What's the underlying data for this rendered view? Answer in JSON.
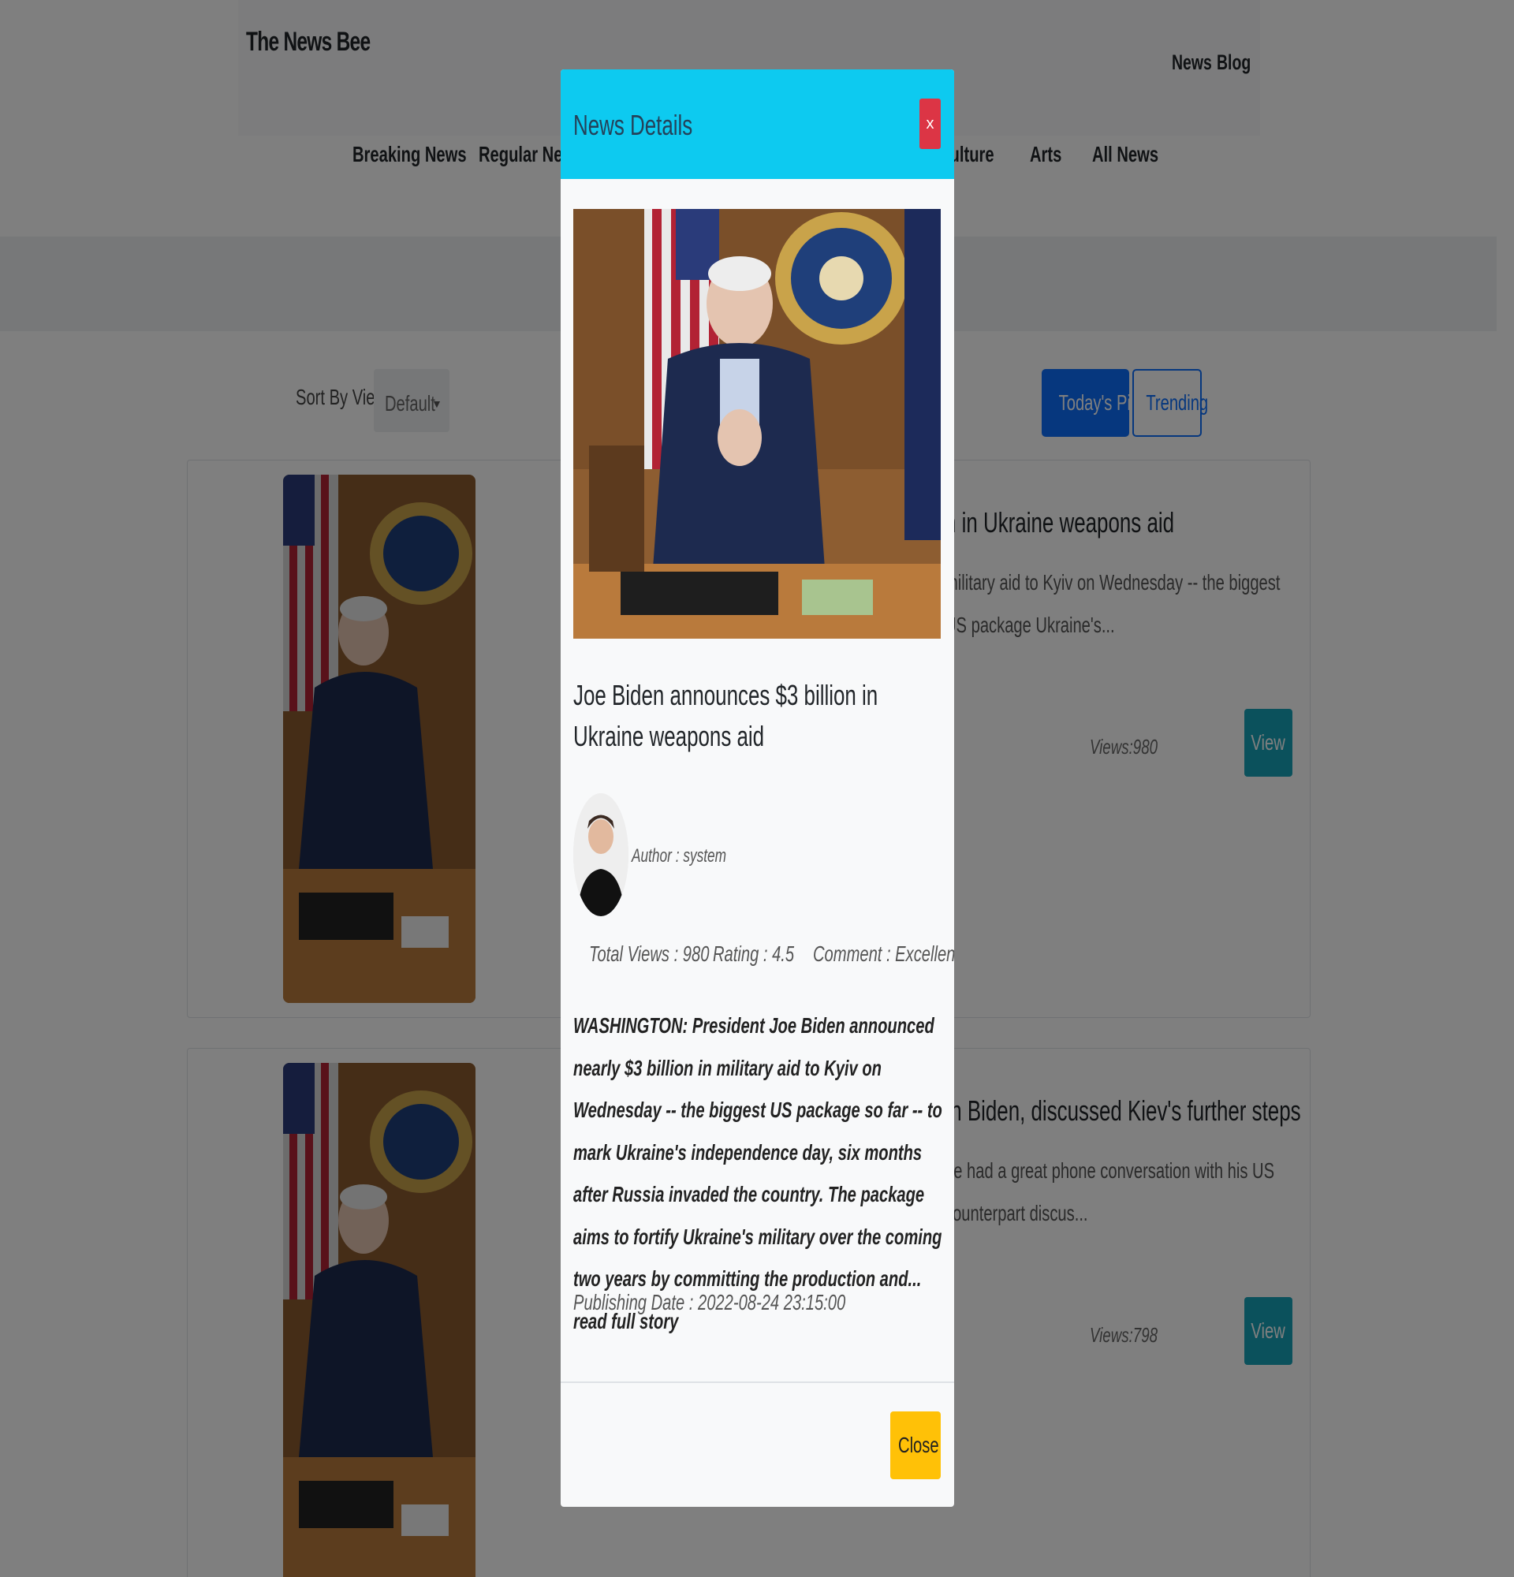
{
  "site": {
    "brand": "The News Bee",
    "top_links": [
      "News",
      "Blog"
    ]
  },
  "categories": [
    "Breaking News",
    "Regular News",
    "Culture",
    "Arts",
    "All News"
  ],
  "toolbar": {
    "sort_label": "Sort By View :",
    "sort_value": "Default",
    "todays_pick": "Today's Pick",
    "trending": "Trending"
  },
  "cards": [
    {
      "title_visible": "n in Ukraine weapons aid",
      "excerpt_visible": "military aid to Kyiv on Wednesday -- the biggest US package Ukraine's...",
      "views": "Views:980",
      "view_button": "View"
    },
    {
      "title_visible": "th Biden, discussed Kiev's further steps",
      "excerpt_visible": "he had a great phone conversation with his US counterpart discus...",
      "views": "Views:798",
      "view_button": "View"
    }
  ],
  "modal": {
    "title": "News Details",
    "close_x": "x",
    "headline": "Joe Biden announces $3 billion in Ukraine weapons aid",
    "author": "Author : system",
    "total_views": "Total Views : 980",
    "rating": "Rating : 4.5",
    "comment": "Comment : Excellent",
    "body": "WASHINGTON: President Joe Biden announced nearly $3 billion in military aid to Kyiv on Wednesday -- the biggest US package so far -- to mark Ukraine's independence day, six months after Russia invaded the country. The package aims to fortify Ukraine's military over the coming two years by committing the production and... read full story",
    "publishing_date": "Publishing Date : 2022-08-24 23:15:00",
    "close_button": "Close"
  },
  "colors": {
    "modal_header": "#0dcaf0",
    "danger": "#dc3545",
    "primary": "#0d6efd",
    "info": "#17a2b8",
    "warning": "#ffc107"
  },
  "icons": [
    "dropdown-caret-icon"
  ]
}
